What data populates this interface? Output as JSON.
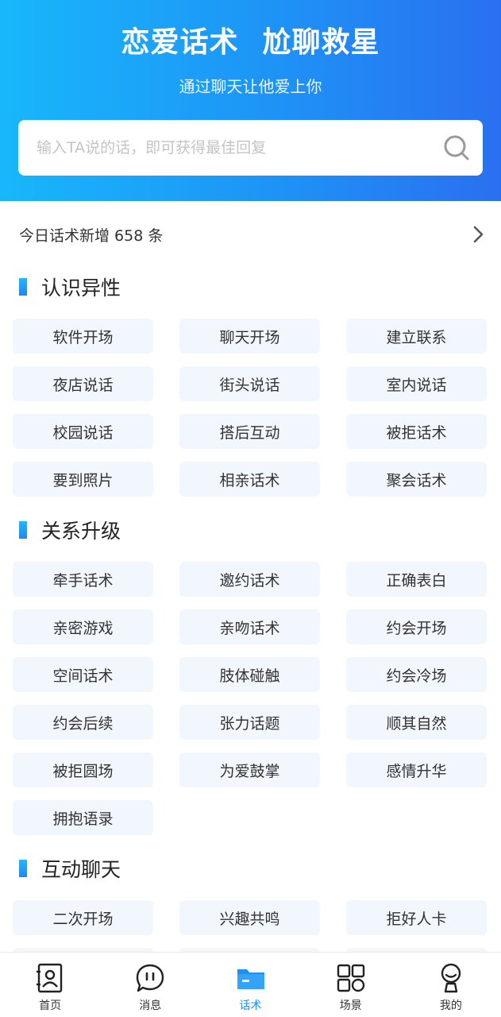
{
  "header": {
    "title_left": "恋爱话术",
    "title_right": "尬聊救星",
    "subtitle": "通过聊天让他爱上你"
  },
  "search": {
    "placeholder": "输入TA说的话，即可获得最佳回复",
    "value": ""
  },
  "stats": {
    "text": "今日话术新增 658 条"
  },
  "sections": [
    {
      "title": "认识异性",
      "items": [
        "软件开场",
        "聊天开场",
        "建立联系",
        "夜店说话",
        "街头说话",
        "室内说话",
        "校园说话",
        "搭后互动",
        "被拒话术",
        "要到照片",
        "相亲话术",
        "聚会话术"
      ]
    },
    {
      "title": "关系升级",
      "items": [
        "牵手话术",
        "邀约话术",
        "正确表白",
        "亲密游戏",
        "亲吻话术",
        "约会开场",
        "空间话术",
        "肢体碰触",
        "约会冷场",
        "约会后续",
        "张力话题",
        "顺其自然",
        "被拒圆场",
        "为爱鼓掌",
        "感情升华",
        "拥抱语录"
      ]
    },
    {
      "title": "互动聊天",
      "items": [
        "二次开场",
        "兴趣共鸣",
        "拒好人卡"
      ]
    }
  ],
  "tabbar": {
    "items": [
      {
        "label": "首页",
        "icon": "contact-book-icon"
      },
      {
        "label": "消息",
        "icon": "chat-bubble-icon"
      },
      {
        "label": "话术",
        "icon": "folder-icon"
      },
      {
        "label": "场景",
        "icon": "grid-icon"
      },
      {
        "label": "我的",
        "icon": "person-icon"
      }
    ],
    "active_index": 2
  },
  "colors": {
    "brand_blue": "#1e8ff5",
    "chip_bg": "#f2f6fd"
  }
}
